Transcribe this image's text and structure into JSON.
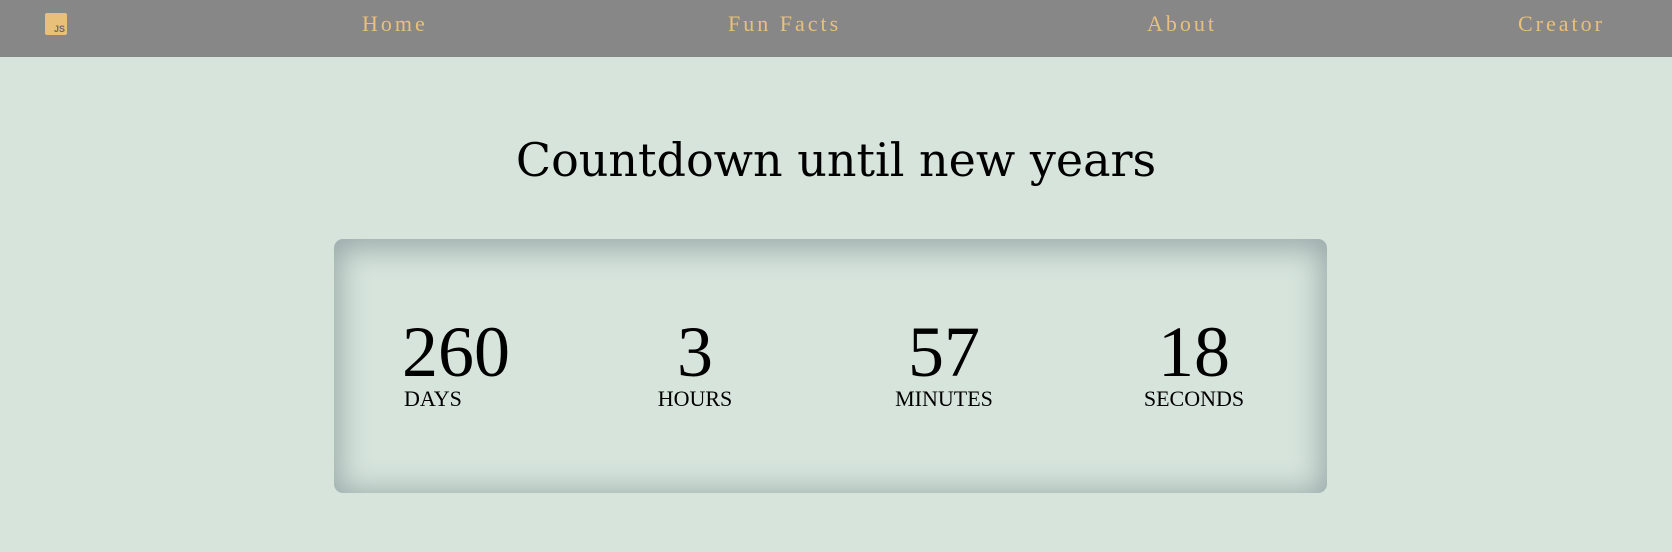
{
  "nav": {
    "logo_text": "JS",
    "items": [
      {
        "label": "Home"
      },
      {
        "label": "Fun Facts"
      },
      {
        "label": "About"
      },
      {
        "label": "Creator"
      }
    ]
  },
  "main": {
    "title": "Countdown until new years",
    "countdown": {
      "days": {
        "value": "260",
        "label": "DAYS"
      },
      "hours": {
        "value": "3",
        "label": "HOURS"
      },
      "minutes": {
        "value": "57",
        "label": "MINUTES"
      },
      "seconds": {
        "value": "18",
        "label": "SECONDS"
      }
    }
  },
  "colors": {
    "navbar_bg": "#878787",
    "nav_text": "#e8c07a",
    "page_bg": "#d6e4dc",
    "text": "#000000"
  }
}
